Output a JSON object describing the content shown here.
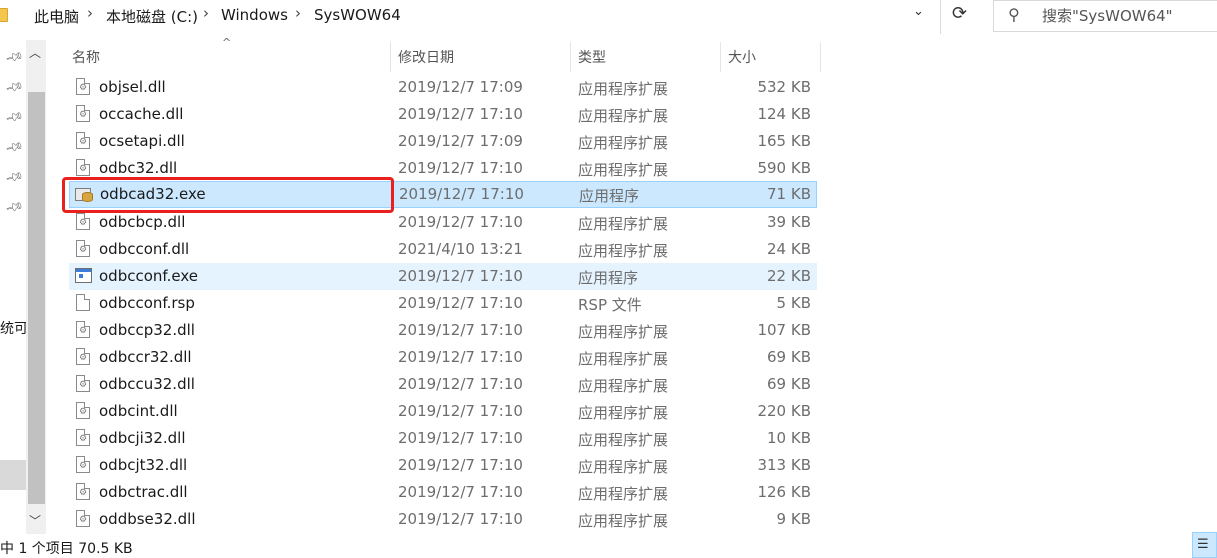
{
  "address": {
    "breadcrumbs": [
      "此电脑",
      "本地磁盘 (C:)",
      "Windows",
      "SysWOW64"
    ],
    "separator": "›",
    "dropdown_glyph": "⌄",
    "refresh_glyph": "⟳"
  },
  "search": {
    "placeholder": "搜索\"SysWOW64\"",
    "icon": "search-icon"
  },
  "nav": {
    "fragment_text": "统可移",
    "pin_count": 6
  },
  "columns": {
    "name": "名称",
    "date": "修改日期",
    "type": "类型",
    "size": "大小",
    "sort_glyph": "^"
  },
  "files": [
    {
      "name": "objsel.dll",
      "date": "2019/12/7 17:09",
      "type": "应用程序扩展",
      "size": "532 KB",
      "icon": "dll-file-icon"
    },
    {
      "name": "occache.dll",
      "date": "2019/12/7 17:10",
      "type": "应用程序扩展",
      "size": "124 KB",
      "icon": "dll-file-icon"
    },
    {
      "name": "ocsetapi.dll",
      "date": "2019/12/7 17:09",
      "type": "应用程序扩展",
      "size": "165 KB",
      "icon": "dll-file-icon"
    },
    {
      "name": "odbc32.dll",
      "date": "2019/12/7 17:10",
      "type": "应用程序扩展",
      "size": "590 KB",
      "icon": "dll-file-icon"
    },
    {
      "name": "odbcad32.exe",
      "date": "2019/12/7 17:10",
      "type": "应用程序",
      "size": "71 KB",
      "icon": "odbc-admin-icon"
    },
    {
      "name": "odbcbcp.dll",
      "date": "2019/12/7 17:10",
      "type": "应用程序扩展",
      "size": "39 KB",
      "icon": "dll-file-icon"
    },
    {
      "name": "odbcconf.dll",
      "date": "2021/4/10 13:21",
      "type": "应用程序扩展",
      "size": "24 KB",
      "icon": "dll-file-icon"
    },
    {
      "name": "odbcconf.exe",
      "date": "2019/12/7 17:10",
      "type": "应用程序",
      "size": "22 KB",
      "icon": "application-icon"
    },
    {
      "name": "odbcconf.rsp",
      "date": "2019/12/7 17:10",
      "type": "RSP 文件",
      "size": "5 KB",
      "icon": "blank-file-icon"
    },
    {
      "name": "odbccp32.dll",
      "date": "2019/12/7 17:10",
      "type": "应用程序扩展",
      "size": "107 KB",
      "icon": "dll-file-icon"
    },
    {
      "name": "odbccr32.dll",
      "date": "2019/12/7 17:10",
      "type": "应用程序扩展",
      "size": "69 KB",
      "icon": "dll-file-icon"
    },
    {
      "name": "odbccu32.dll",
      "date": "2019/12/7 17:10",
      "type": "应用程序扩展",
      "size": "69 KB",
      "icon": "dll-file-icon"
    },
    {
      "name": "odbcint.dll",
      "date": "2019/12/7 17:10",
      "type": "应用程序扩展",
      "size": "220 KB",
      "icon": "dll-file-icon"
    },
    {
      "name": "odbcji32.dll",
      "date": "2019/12/7 17:10",
      "type": "应用程序扩展",
      "size": "10 KB",
      "icon": "dll-file-icon"
    },
    {
      "name": "odbcjt32.dll",
      "date": "2019/12/7 17:10",
      "type": "应用程序扩展",
      "size": "313 KB",
      "icon": "dll-file-icon"
    },
    {
      "name": "odbctrac.dll",
      "date": "2019/12/7 17:10",
      "type": "应用程序扩展",
      "size": "126 KB",
      "icon": "dll-file-icon"
    },
    {
      "name": "oddbse32.dll",
      "date": "2019/12/7 17:10",
      "type": "应用程序扩展",
      "size": "9 KB",
      "icon": "dll-file-icon"
    }
  ],
  "selected_file": "odbcad32.exe",
  "hovered_file": "odbcconf.exe",
  "status": {
    "text": "中 1 个项目  70.5 KB"
  },
  "colors": {
    "selection_bg": "#cce8ff",
    "hover_bg": "#e5f3ff",
    "annotation_red": "#e8201e"
  }
}
